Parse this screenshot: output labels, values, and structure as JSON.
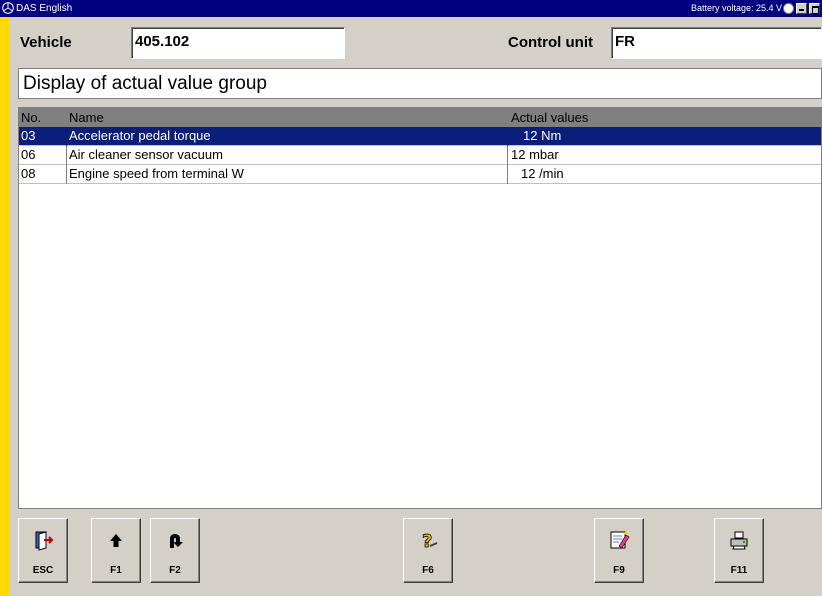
{
  "window": {
    "title": "DAS English",
    "battery": "Battery voltage: 25.4 V"
  },
  "header": {
    "vehicle_label": "Vehicle",
    "vehicle_value": "405.102",
    "control_unit_label": "Control unit",
    "control_unit_value": "FR"
  },
  "heading": "Display of actual value group",
  "table": {
    "columns": [
      "No.",
      "Name",
      "Actual values"
    ],
    "rows": [
      {
        "no": "03",
        "name": "Accelerator pedal torque",
        "value": "12 Nm",
        "selected": true
      },
      {
        "no": "06",
        "name": "Air cleaner sensor vacuum",
        "value": "12 mbar",
        "selected": false
      },
      {
        "no": "08",
        "name": "Engine speed from terminal W",
        "value": "12 /min",
        "selected": false
      }
    ]
  },
  "toolbar": {
    "buttons": [
      {
        "label": "ESC",
        "icon": "exit-door-icon"
      },
      {
        "label": "F1",
        "icon": "arrow-up-icon"
      },
      {
        "label": "F2",
        "icon": "return-arrow-icon"
      },
      {
        "label": "F6",
        "icon": "help-question-icon"
      },
      {
        "label": "F9",
        "icon": "edit-pencil-icon"
      },
      {
        "label": "F11",
        "icon": "printer-icon"
      }
    ]
  },
  "colors": {
    "titlebar": "#000080",
    "selection": "#0a1e7a",
    "left_edge": "#ffd800",
    "background": "#d4d0c8"
  }
}
